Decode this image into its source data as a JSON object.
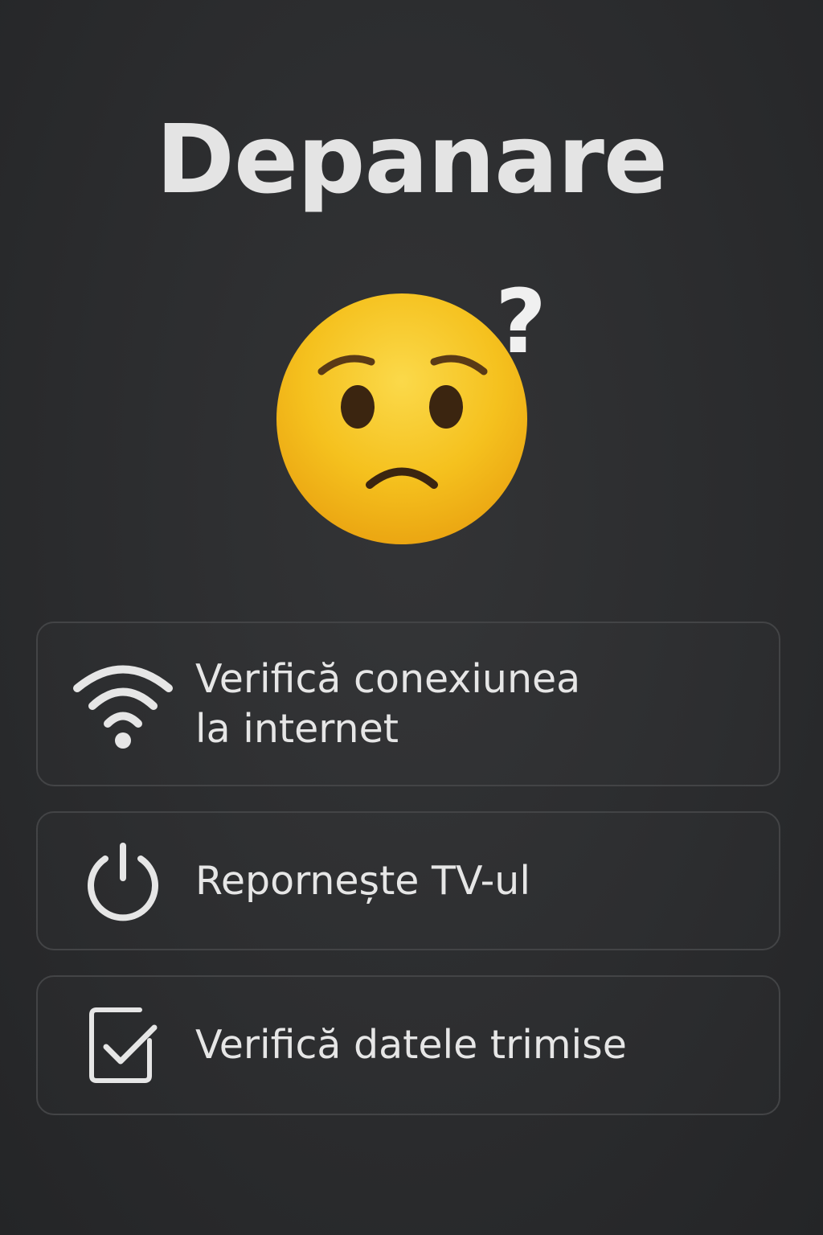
{
  "page": {
    "title": "Depanare"
  },
  "status_icon": {
    "name": "worried-face-icon",
    "accent": "#f5c11e",
    "question_mark": "?"
  },
  "options": [
    {
      "icon": "wifi-icon",
      "label": "Verifică conexiunea\nla internet"
    },
    {
      "icon": "power-icon",
      "label": "Repornește TV-ul"
    },
    {
      "icon": "checkbox-icon",
      "label": "Verifică datele trimise"
    }
  ],
  "colors": {
    "background": "#2b2c2e",
    "text": "#e6e6e6",
    "card_border": "#434446"
  }
}
